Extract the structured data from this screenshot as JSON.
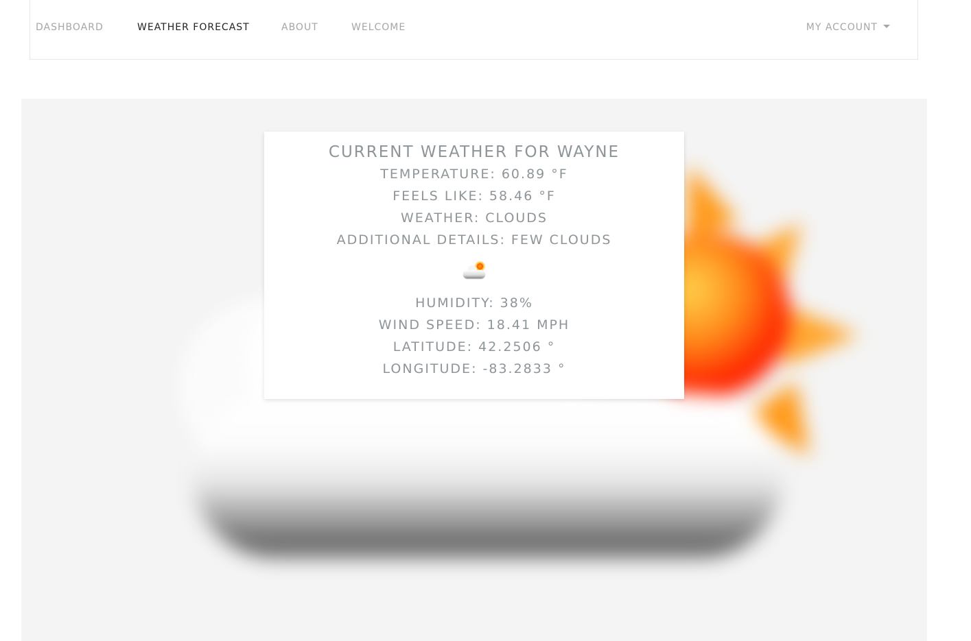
{
  "nav": {
    "items": [
      {
        "label": "DASHBOARD",
        "active": false
      },
      {
        "label": "WEATHER FORECAST",
        "active": true
      },
      {
        "label": "ABOUT",
        "active": false
      },
      {
        "label": "WELCOME",
        "active": false
      }
    ],
    "account_label": "MY ACCOUNT"
  },
  "weather": {
    "title": "CURRENT WEATHER FOR WAYNE",
    "temperature": "TEMPERATURE: 60.89 °F",
    "feels_like": "FEELS LIKE: 58.46 °F",
    "condition": "WEATHER: CLOUDS",
    "details": "ADDITIONAL DETAILS: FEW CLOUDS",
    "icon": "few-clouds-icon",
    "humidity": "HUMIDITY: 38%",
    "wind_speed": "WIND SPEED: 18.41 MPH",
    "latitude": "LATITUDE: 42.2506 °",
    "longitude": "LONGITUDE: -83.2833 °"
  },
  "colors": {
    "text_muted": "#8e9599",
    "nav_inactive": "#a6a6a6",
    "nav_active": "#222222",
    "panel_background": "#f4f4f4"
  }
}
